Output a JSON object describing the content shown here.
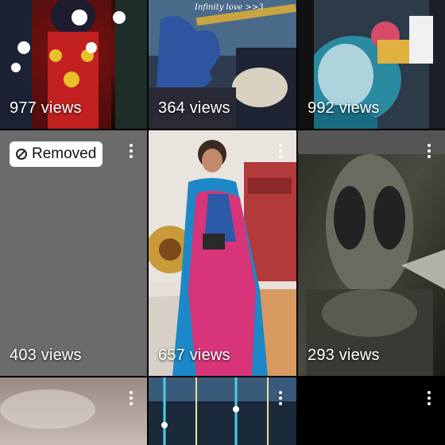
{
  "tiles": [
    {
      "views": "977 views"
    },
    {
      "views": "364 views",
      "caption": "Infinity love >>3"
    },
    {
      "views": "992 views"
    },
    {
      "views": "403 views",
      "badge": "Removed"
    },
    {
      "views": "657 views"
    },
    {
      "views": "293 views"
    },
    {},
    {},
    {}
  ],
  "icons": {
    "more": "more-vertical-icon",
    "removed": "ban-icon"
  },
  "colors": {
    "background": "#000000",
    "removed_tile": "#6b6b6b",
    "text": "#ffffff"
  }
}
